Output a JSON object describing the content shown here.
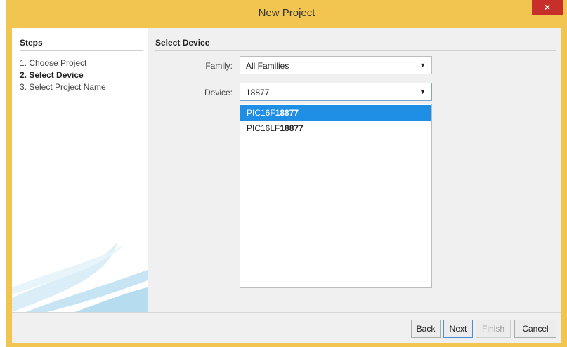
{
  "dialog": {
    "title": "New Project",
    "close_glyph": "×"
  },
  "steps": {
    "header": "Steps",
    "items": [
      {
        "label": "1. Choose Project",
        "active": false
      },
      {
        "label": "2. Select Device",
        "active": true
      },
      {
        "label": "3. Select Project Name",
        "active": false
      }
    ]
  },
  "main": {
    "header": "Select Device",
    "family": {
      "label": "Family:",
      "value": "All Families"
    },
    "device": {
      "label": "Device:",
      "value": "18877"
    },
    "device_options": [
      {
        "prefix": "PIC16F",
        "match": "18877",
        "selected": true
      },
      {
        "prefix": "PIC16LF",
        "match": "18877",
        "selected": false
      }
    ]
  },
  "buttons": {
    "back": "Back",
    "next": "Next",
    "finish": "Finish",
    "cancel": "Cancel"
  },
  "colors": {
    "frame": "#f1c54f",
    "close": "#c7302a",
    "selection": "#1e8fe5"
  }
}
